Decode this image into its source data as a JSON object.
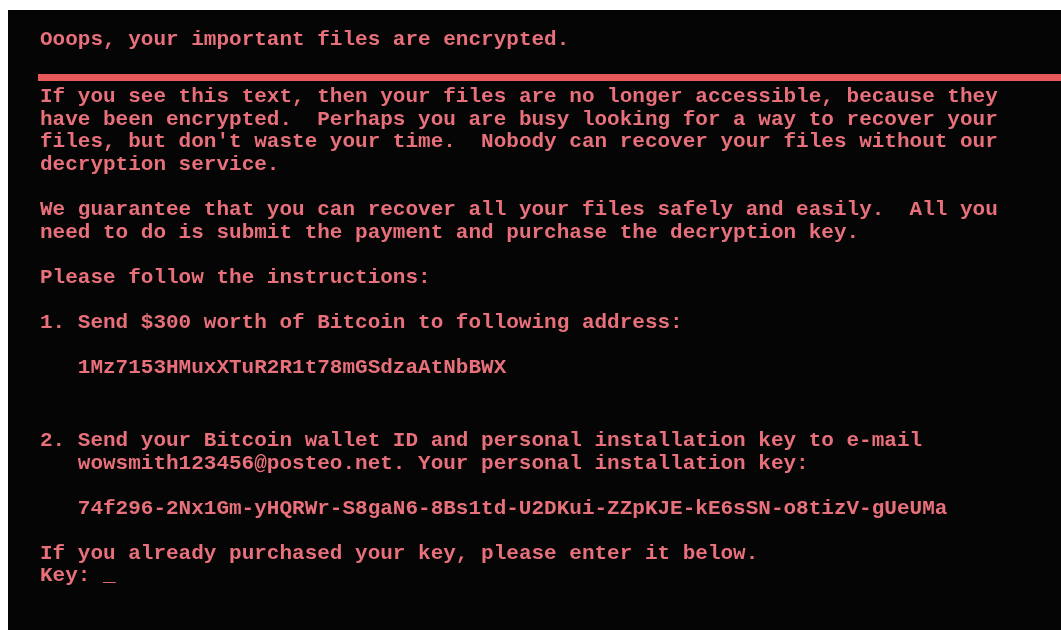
{
  "title": "Ooops, your important files are encrypted.",
  "blocks": [
    {
      "kind": "rule"
    },
    {
      "kind": "paragraph",
      "lines": [
        "If you see this text, then your files are no longer accessible, because they",
        "have been encrypted.  Perhaps you are busy looking for a way to recover your",
        "files, but don't waste your time.  Nobody can recover your files without our",
        "decryption service."
      ]
    },
    {
      "kind": "paragraph",
      "lines": [
        "We guarantee that you can recover all your files safely and easily.  All you",
        "need to do is submit the payment and purchase the decryption key."
      ]
    },
    {
      "kind": "paragraph",
      "lines": [
        "Please follow the instructions:"
      ]
    },
    {
      "kind": "step",
      "number": "1.",
      "lines": [
        "Send $300 worth of Bitcoin to following address:"
      ]
    },
    {
      "kind": "code",
      "lines": [
        "1Mz7153HMuxXTuR2R1t78mGSdzaAtNbBWX"
      ]
    },
    {
      "kind": "step",
      "number": "2.",
      "lines": [
        "Send your Bitcoin wallet ID and personal installation key to e-mail",
        "wowsmith123456@posteo.net. Your personal installation key:"
      ]
    },
    {
      "kind": "code",
      "lines": [
        "74f296-2Nx1Gm-yHQRWr-S8gaN6-8Bs1td-U2DKui-ZZpKJE-kE6sSN-o8tizV-gUeUMa"
      ]
    },
    {
      "kind": "paragraph",
      "lines": [
        "If you already purchased your key, please enter it below."
      ]
    }
  ],
  "key_prompt": {
    "label": "Key:",
    "cursor": "_"
  }
}
